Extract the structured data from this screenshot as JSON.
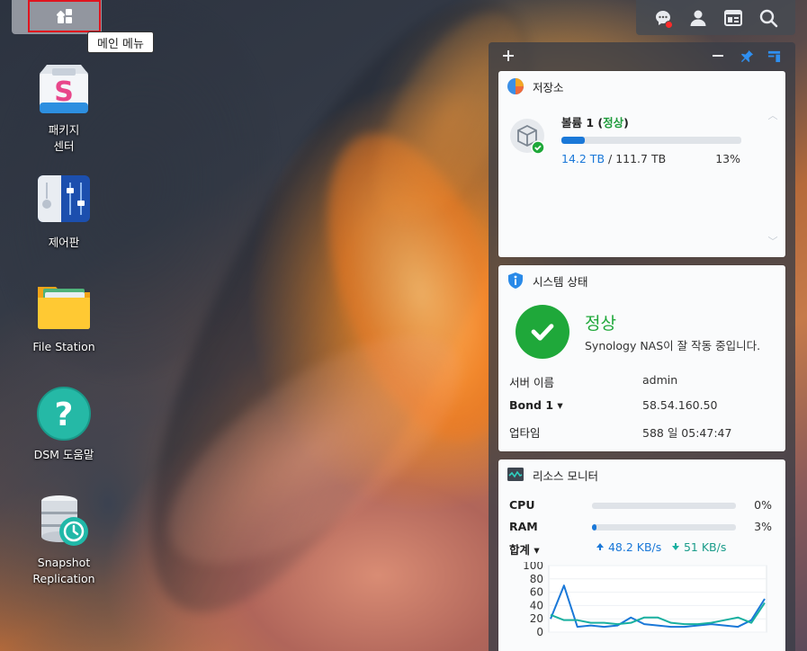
{
  "topbar": {
    "main_menu_tooltip": "메인 메뉴",
    "icons": [
      "chat-icon",
      "user-icon",
      "widgets-icon",
      "search-icon"
    ],
    "notification_color": "#ff2a2a"
  },
  "desktop": {
    "items": [
      {
        "label": "패키지\n센터",
        "icon": "package-center-icon"
      },
      {
        "label": "제어판",
        "icon": "control-panel-icon"
      },
      {
        "label": "File Station",
        "icon": "folder-icon"
      },
      {
        "label": "DSM 도움말",
        "icon": "help-icon"
      },
      {
        "label": "Snapshot Replication",
        "icon": "snapshot-replication-icon"
      }
    ]
  },
  "widgets": {
    "storage": {
      "title": "저장소",
      "volume_name": "볼륨 1 (",
      "volume_status": "정상",
      "volume_close": ")",
      "used": "14.2 TB",
      "separator": " / ",
      "total": "111.7 TB",
      "percent": "13%",
      "usage_fraction": 0.13
    },
    "system_status": {
      "title": "시스템 상태",
      "status": "정상",
      "description": "Synology NAS이 잘 작동 중입니다.",
      "rows": [
        {
          "key": "서버 이름",
          "value": "admin"
        },
        {
          "key": "Bond 1 ▾",
          "value": "58.54.160.50"
        },
        {
          "key": "업타임",
          "value": "588 일 05:47:47"
        }
      ]
    },
    "resource_monitor": {
      "title": "리소스 모니터",
      "cpu_label": "CPU",
      "cpu_percent": "0%",
      "cpu_fraction": 0.0,
      "ram_label": "RAM",
      "ram_percent": "3%",
      "ram_fraction": 0.03,
      "net_label": "합계 ▾",
      "upload": "48.2 KB/s",
      "download": "51 KB/s",
      "colors": {
        "upload": "#1a78d8",
        "download": "#1ab0a0"
      }
    }
  },
  "chart_data": {
    "type": "line",
    "ylim": [
      0,
      100
    ],
    "yticks": [
      "100",
      "80",
      "60",
      "40",
      "20",
      "0"
    ],
    "series": [
      {
        "values": [
          20,
          70,
          8,
          10,
          8,
          10,
          22,
          12,
          10,
          8,
          8,
          10,
          12,
          10,
          8,
          18,
          50
        ]
      },
      {
        "values": [
          26,
          18,
          18,
          14,
          14,
          12,
          14,
          22,
          22,
          14,
          12,
          12,
          14,
          18,
          22,
          14,
          44
        ]
      }
    ]
  }
}
